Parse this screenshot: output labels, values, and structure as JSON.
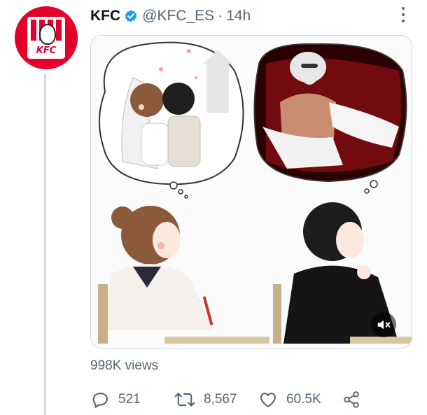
{
  "tweet": {
    "author_name": "KFC",
    "handle": "@KFC_ES",
    "separator": "·",
    "time": "14h",
    "avatar_text": "KFC"
  },
  "media": {
    "type": "video",
    "description_icon": "mute-icon"
  },
  "stats": {
    "views": "998K views",
    "replies": "521",
    "retweets": "8,567",
    "likes": "60.5K"
  },
  "colors": {
    "brand": "#e4002b",
    "verified": "#1d9bf0",
    "secondary_text": "#536471",
    "primary_text": "#0f1419"
  },
  "icons": {
    "verified": "verified-badge-icon",
    "more": "more-icon",
    "reply": "reply-icon",
    "retweet": "retweet-icon",
    "like": "like-icon",
    "share": "share-icon"
  }
}
